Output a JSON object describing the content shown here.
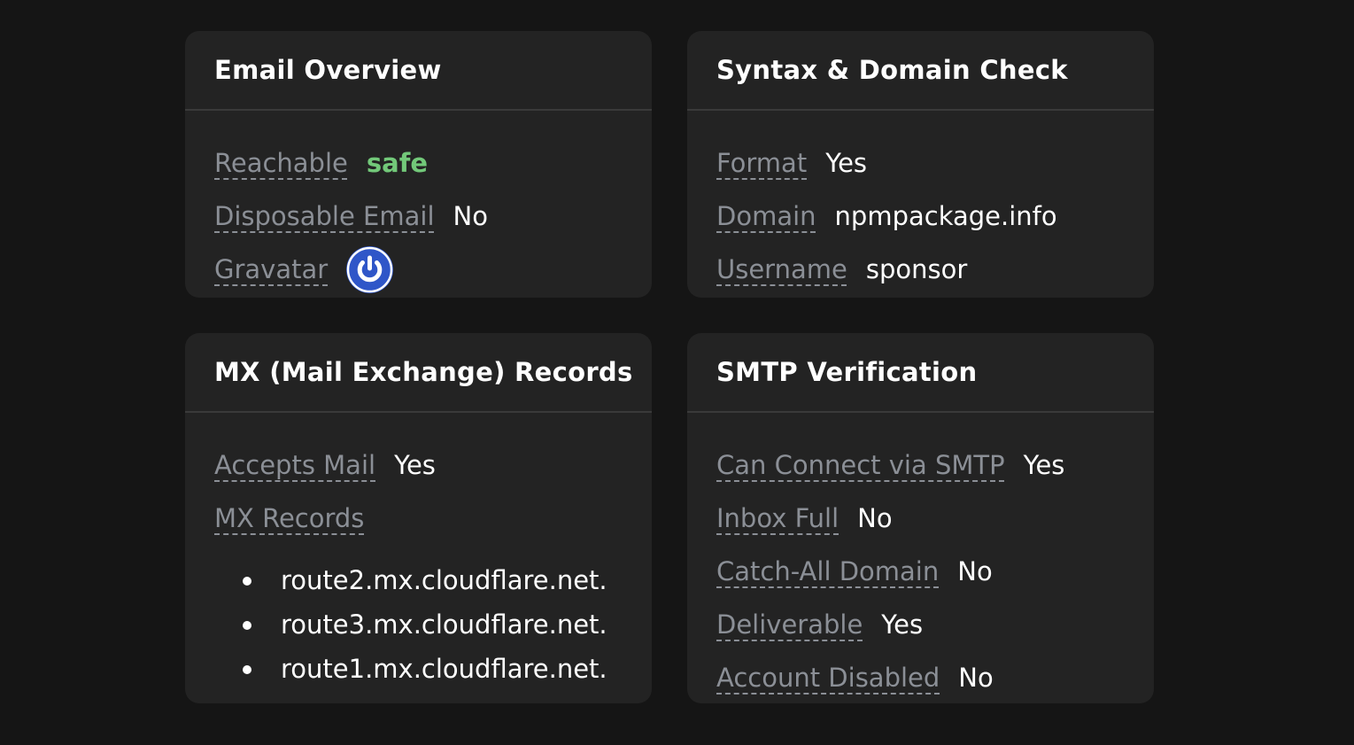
{
  "overview": {
    "title": "Email Overview",
    "rows": [
      {
        "label": "Reachable",
        "value": "safe"
      },
      {
        "label": "Disposable Email",
        "value": "No"
      },
      {
        "label": "Gravatar",
        "icon": "gravatar-power-icon"
      }
    ]
  },
  "syntax": {
    "title": "Syntax & Domain Check",
    "rows": [
      {
        "label": "Format",
        "value": "Yes"
      },
      {
        "label": "Domain",
        "value": "npmpackage.info"
      },
      {
        "label": "Username",
        "value": "sponsor"
      }
    ]
  },
  "mx": {
    "title": "MX (Mail Exchange) Records",
    "rows": [
      {
        "label": "Accepts Mail",
        "value": "Yes"
      },
      {
        "label": "MX Records"
      }
    ],
    "records": [
      "route2.mx.cloudflare.net.",
      "route3.mx.cloudflare.net.",
      "route1.mx.cloudflare.net."
    ]
  },
  "smtp": {
    "title": "SMTP Verification",
    "rows": [
      {
        "label": "Can Connect via SMTP",
        "value": "Yes"
      },
      {
        "label": "Inbox Full",
        "value": "No"
      },
      {
        "label": "Catch-All Domain",
        "value": "No"
      },
      {
        "label": "Deliverable",
        "value": "Yes"
      },
      {
        "label": "Account Disabled",
        "value": "No"
      }
    ]
  },
  "colors": {
    "background": "#151515",
    "card": "#232323",
    "label": "#8b8f96",
    "safe": "#72c879",
    "gravatar": "#2f56c8"
  }
}
